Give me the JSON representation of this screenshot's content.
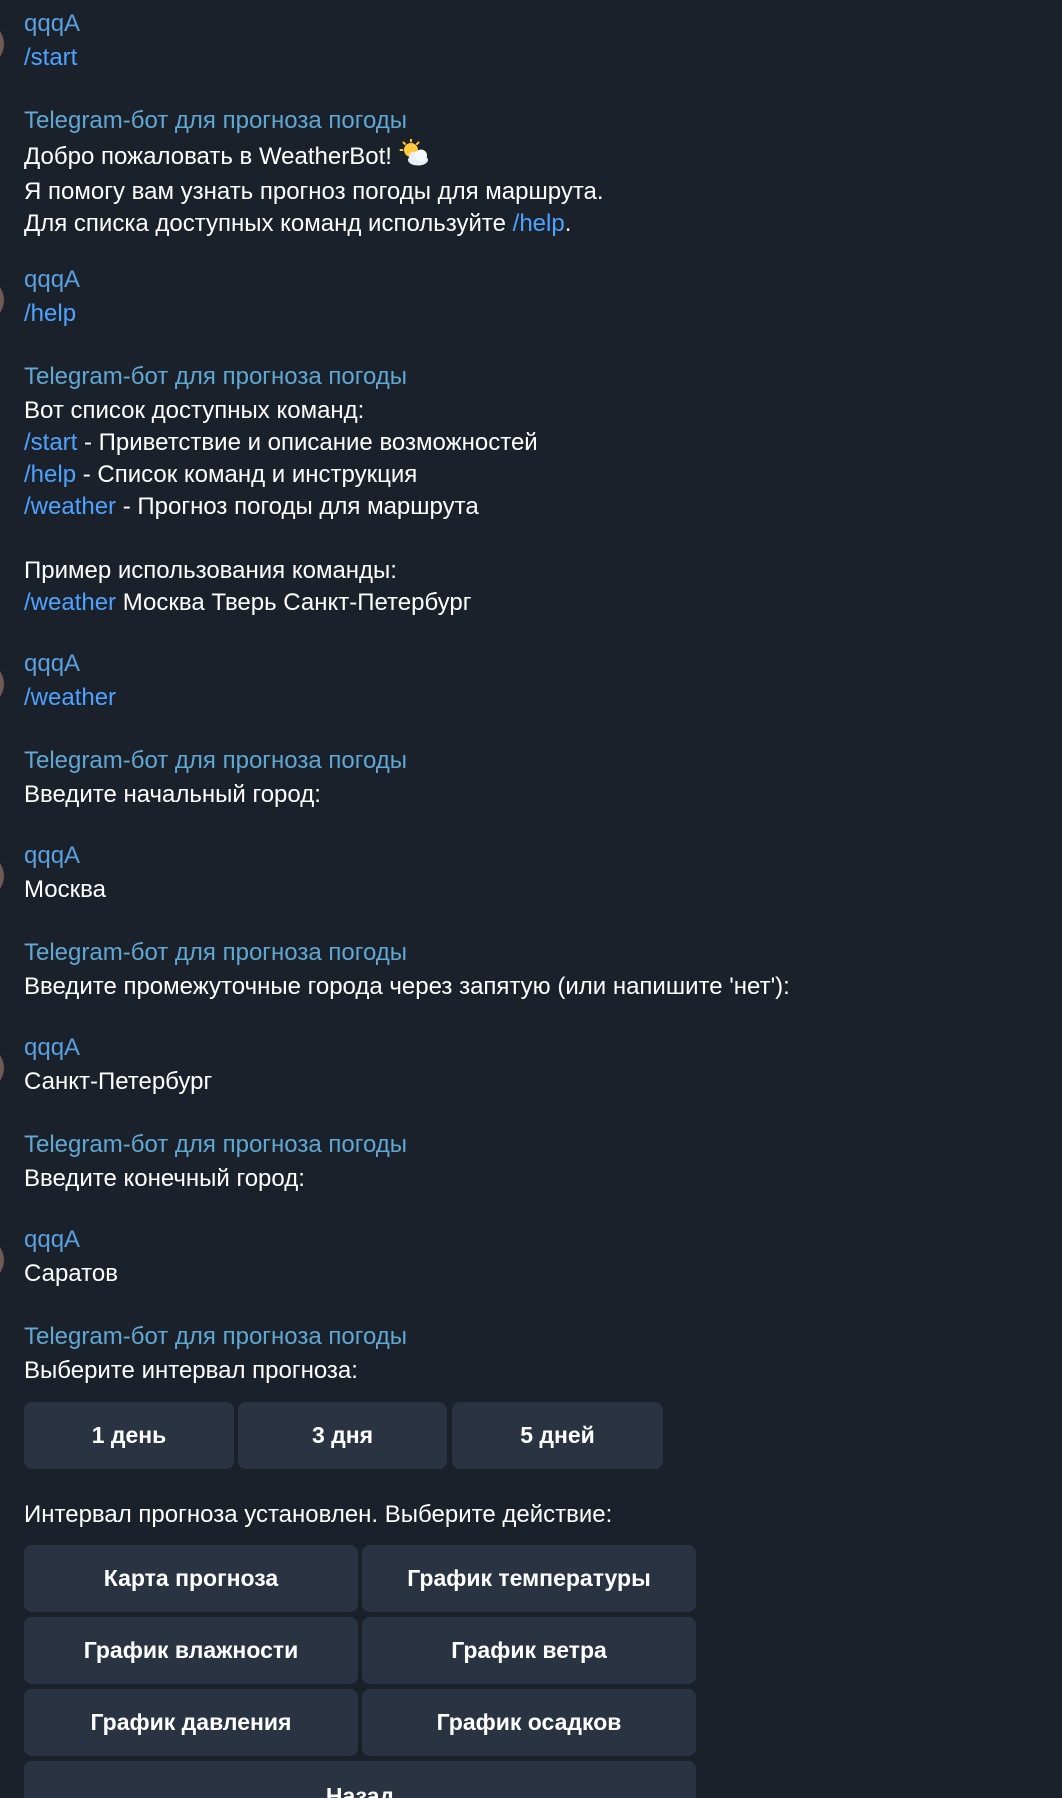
{
  "user_name": "qqqA",
  "bot_name": "Telegram-бот для прогноза погоды",
  "messages": {
    "m1": {
      "text": "/start"
    },
    "m2": {
      "line1": "Добро пожаловать в WeatherBot!",
      "emoji": "sun-behind-cloud",
      "line2": "Я помогу вам узнать прогноз погоды для маршрута.",
      "line3_pre": "Для списка доступных команд используйте ",
      "line3_cmd": "/help",
      "line3_post": "."
    },
    "m3": {
      "text": "/help"
    },
    "m4": {
      "intro": "Вот список доступных команд:",
      "cmds": [
        {
          "cmd": "/start",
          "desc": " - Приветствие и описание возможностей"
        },
        {
          "cmd": "/help",
          "desc": " - Список команд и инструкция"
        },
        {
          "cmd": "/weather",
          "desc": " - Прогноз погоды для маршрута"
        }
      ],
      "example_title": "Пример использования команды:",
      "example_cmd": "/weather",
      "example_args": " Москва Тверь Санкт-Петербург"
    },
    "m5": {
      "text": "/weather"
    },
    "m6": {
      "text": "Введите начальный город:"
    },
    "m7": {
      "text": "Москва"
    },
    "m8": {
      "text": "Введите промежуточные города через запятую (или напишите 'нет'):"
    },
    "m9": {
      "text": "Санкт-Петербург"
    },
    "m10": {
      "text": "Введите конечный город:"
    },
    "m11": {
      "text": "Саратов"
    },
    "m12": {
      "text": "Выберите интервал прогноза:"
    },
    "m13": {
      "text": "Интервал прогноза установлен. Выберите действие:"
    }
  },
  "interval_buttons": [
    "1 день",
    "3 дня",
    "5 дней"
  ],
  "action_buttons": [
    "Карта прогноза",
    "График температуры",
    "График влажности",
    "График ветра",
    "График давления",
    "График осадков",
    "Назад"
  ]
}
